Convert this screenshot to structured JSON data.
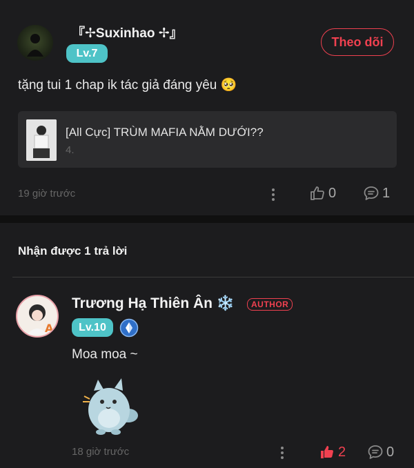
{
  "post": {
    "username": "『✢Suxinhao ✢』",
    "level": "Lv.7",
    "follow_label": "Theo dõi",
    "content": "tặng tui 1 chap ik tác giả đáng yêu 🥺",
    "card": {
      "title": "[All Cực] TRÙM MAFIA NẰM DƯỚI??",
      "subtitle": "4."
    },
    "time": "19 giờ trước",
    "likes": "0",
    "comments": "1"
  },
  "replies_header": "Nhận được 1 trả lời",
  "reply": {
    "username": "Trương Hạ Thiên Ân ❄️",
    "author_badge": "AUTHOR",
    "level": "Lv.10",
    "content": "Moa moa ~",
    "time": "18 giờ trước",
    "likes": "2",
    "comments": "0"
  },
  "colors": {
    "accent": "#f04150",
    "level": "#4ec3c7",
    "background": "#1c1c1e"
  }
}
